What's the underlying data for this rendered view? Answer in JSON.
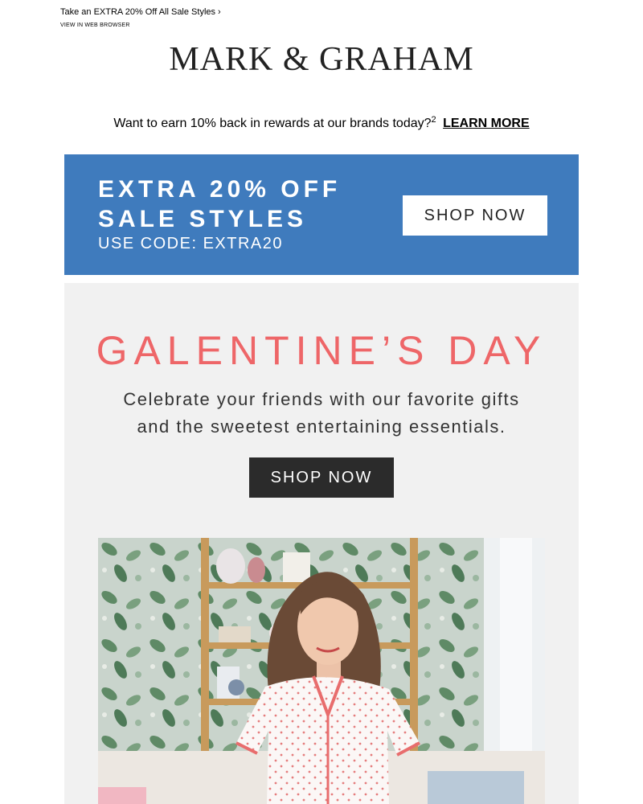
{
  "preheader": {
    "offer_link": "Take an EXTRA 20% Off All Sale Styles ›",
    "web_link": "VIEW IN WEB BROWSER"
  },
  "brand": {
    "logo": "MARK & GRAHAM"
  },
  "rewards": {
    "text": "Want to earn 10% back in rewards at our brands today?",
    "footnote": "2",
    "link": "LEARN MORE"
  },
  "promo": {
    "line1": "EXTRA 20% OFF",
    "line2": "SALE STYLES",
    "code": "USE CODE: EXTRA20",
    "button": "SHOP NOW",
    "color": "#3f7bbd"
  },
  "hero": {
    "title": "GALENTINE’S DAY",
    "sub1": "Celebrate your friends with our favorite gifts",
    "sub2": "and the sweetest entertaining essentials.",
    "button": "SHOP NOW",
    "title_color": "#ee6668",
    "image": "woman-in-heart-print-pajamas-photo"
  }
}
